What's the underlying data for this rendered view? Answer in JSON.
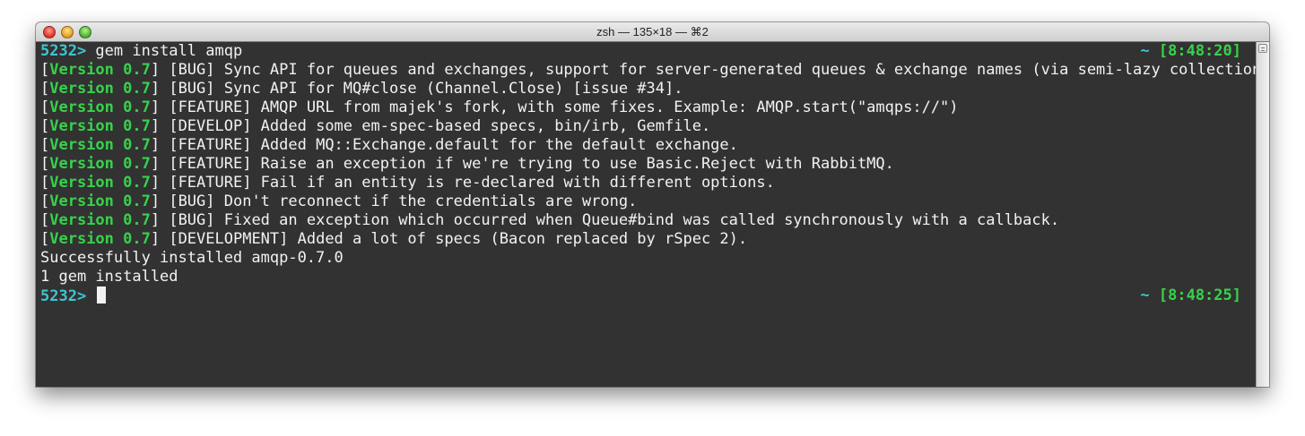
{
  "window": {
    "title": "zsh — 135×18 — ⌘2"
  },
  "terminal": {
    "command_line": {
      "prompt": "5232>",
      "command": " gem install amqp",
      "time_tilde": "~",
      "time": " [8:48:20]"
    },
    "changelog": [
      {
        "version": "Version 0.7",
        "text": " [BUG] Sync API for queues and exchanges, support for server-generated queues & exchange names (via semi-lazy collection)."
      },
      {
        "version": "Version 0.7",
        "text": " [BUG] Sync API for MQ#close (Channel.Close) [issue #34]."
      },
      {
        "version": "Version 0.7",
        "text": " [FEATURE] AMQP URL from majek's fork, with some fixes. Example: AMQP.start(\"amqps://\")"
      },
      {
        "version": "Version 0.7",
        "text": " [DEVELOP] Added some em-spec-based specs, bin/irb, Gemfile."
      },
      {
        "version": "Version 0.7",
        "text": " [FEATURE] Added MQ::Exchange.default for the default exchange."
      },
      {
        "version": "Version 0.7",
        "text": " [FEATURE] Raise an exception if we're trying to use Basic.Reject with RabbitMQ."
      },
      {
        "version": "Version 0.7",
        "text": " [FEATURE] Fail if an entity is re-declared with different options."
      },
      {
        "version": "Version 0.7",
        "text": " [BUG] Don't reconnect if the credentials are wrong."
      },
      {
        "version": "Version 0.7",
        "text": " [BUG] Fixed an exception which occurred when Queue#bind was called synchronously with a callback."
      },
      {
        "version": "Version 0.7",
        "text": " [DEVELOPMENT] Added a lot of specs (Bacon replaced by rSpec 2)."
      }
    ],
    "output": [
      "Successfully installed amqp-0.7.0",
      "1 gem installed"
    ],
    "current_prompt": {
      "prompt": "5232>",
      "time_tilde": "~",
      "time": " [8:48:25]"
    }
  },
  "colors": {
    "background": "#323232",
    "prompt": "#3fc4d2",
    "version": "#36d34a",
    "text": "#f2f2f2"
  }
}
